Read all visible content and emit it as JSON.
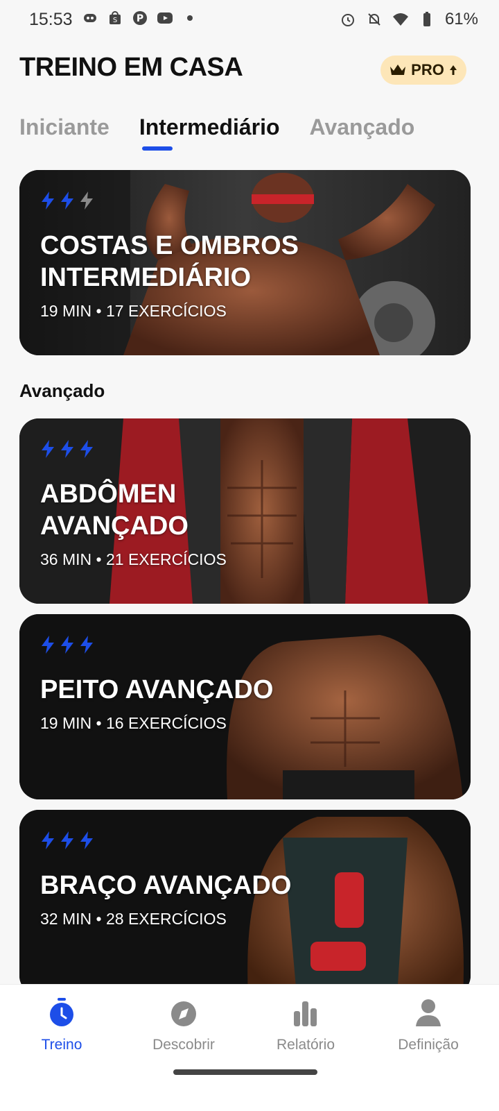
{
  "status_bar": {
    "time": "15:53",
    "left_icons": [
      "discord-icon",
      "shop-icon",
      "pinterest-icon",
      "youtube-icon",
      "dot-icon"
    ],
    "right_icons": [
      "alarm-icon",
      "mute-icon",
      "wifi-icon",
      "battery-icon"
    ],
    "battery": "61%"
  },
  "header": {
    "title": "TREINO EM CASA",
    "pro_label": "PRO"
  },
  "tabs": [
    {
      "label": "Iniciante"
    },
    {
      "label": "Intermediário"
    },
    {
      "label": "Avançado"
    }
  ],
  "cards": [
    {
      "title_line1": "COSTAS E OMBROS",
      "title_line2": "INTERMEDIÁRIO",
      "meta": "19 MIN • 17 EXERCÍCIOS",
      "level": 2
    },
    {
      "title_line1": "ABDÔMEN",
      "title_line2": "AVANÇADO",
      "meta": "36 MIN • 21 EXERCÍCIOS",
      "level": 3
    },
    {
      "title_line1": "PEITO AVANÇADO",
      "title_line2": "",
      "meta": "19 MIN • 16 EXERCÍCIOS",
      "level": 3
    },
    {
      "title_line1": "BRAÇO AVANÇADO",
      "title_line2": "",
      "meta": "32 MIN • 28 EXERCÍCIOS",
      "level": 3
    }
  ],
  "section": {
    "title": "Avançado"
  },
  "bottom_nav": [
    {
      "label": "Treino",
      "icon": "stopwatch-icon"
    },
    {
      "label": "Descobrir",
      "icon": "compass-icon"
    },
    {
      "label": "Relatório",
      "icon": "bar-chart-icon"
    },
    {
      "label": "Definição",
      "icon": "profile-icon"
    }
  ],
  "colors": {
    "accent": "#1d4ee8",
    "pro_bg": "#fde6b8",
    "bolt_inactive": "#8a8a8a"
  }
}
